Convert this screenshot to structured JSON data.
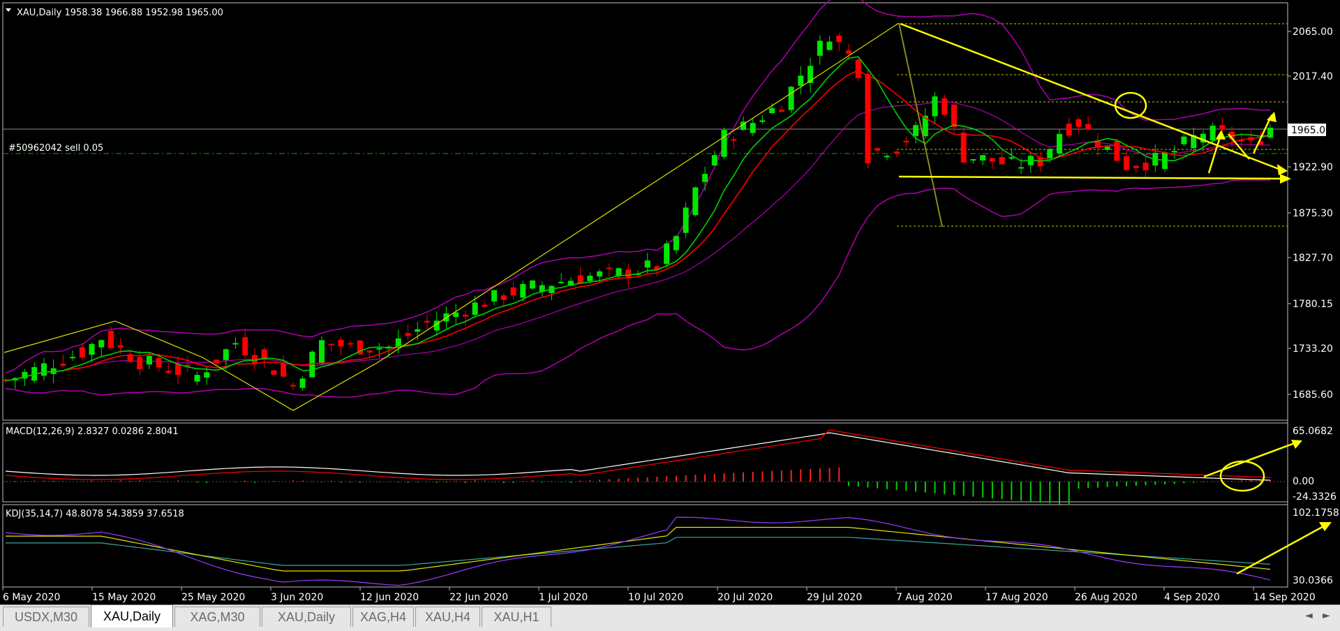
{
  "main_panel": {
    "header": "XAU,Daily  1958.38 1966.88 1952.98 1965.00",
    "order_label": "#50962042 sell 0.05",
    "current_price": "1965.00",
    "price_ticks": [
      "2065.00",
      "2017.40",
      "1922.90",
      "1875.30",
      "1827.70",
      "1780.15",
      "1733.20",
      "1685.60"
    ]
  },
  "macd_panel": {
    "header": "MACD(12,26,9) 2.8327 0.0286 2.8041",
    "ticks": [
      "65.0682",
      "0.00",
      "-24.3326"
    ]
  },
  "kdj_panel": {
    "header": "KDJ(35,14,7) 48.8078 54.3859 37.6518",
    "ticks": [
      "102.1758",
      "30.0366"
    ]
  },
  "date_ticks": [
    "6 May 2020",
    "15 May 2020",
    "25 May 2020",
    "3 Jun 2020",
    "12 Jun 2020",
    "22 Jun 2020",
    "1 Jul 2020",
    "10 Jul 2020",
    "20 Jul 2020",
    "29 Jul 2020",
    "7 Aug 2020",
    "17 Aug 2020",
    "26 Aug 2020",
    "4 Sep 2020",
    "14 Sep 2020"
  ],
  "tabs": [
    "USDX,M30",
    "XAU,Daily",
    "XAG,M30",
    "XAU,Daily",
    "XAG,H4",
    "XAU,H4",
    "XAU,H1"
  ],
  "active_tab": 1,
  "colors": {
    "bull_candle": "#00e600",
    "bear_candle": "#ff0000",
    "bollinger": "#b000b0",
    "ma_red": "#ff0000",
    "ma_green": "#00d200",
    "annotations": "#ffff00",
    "grid_dotted": "#c8c800"
  }
}
